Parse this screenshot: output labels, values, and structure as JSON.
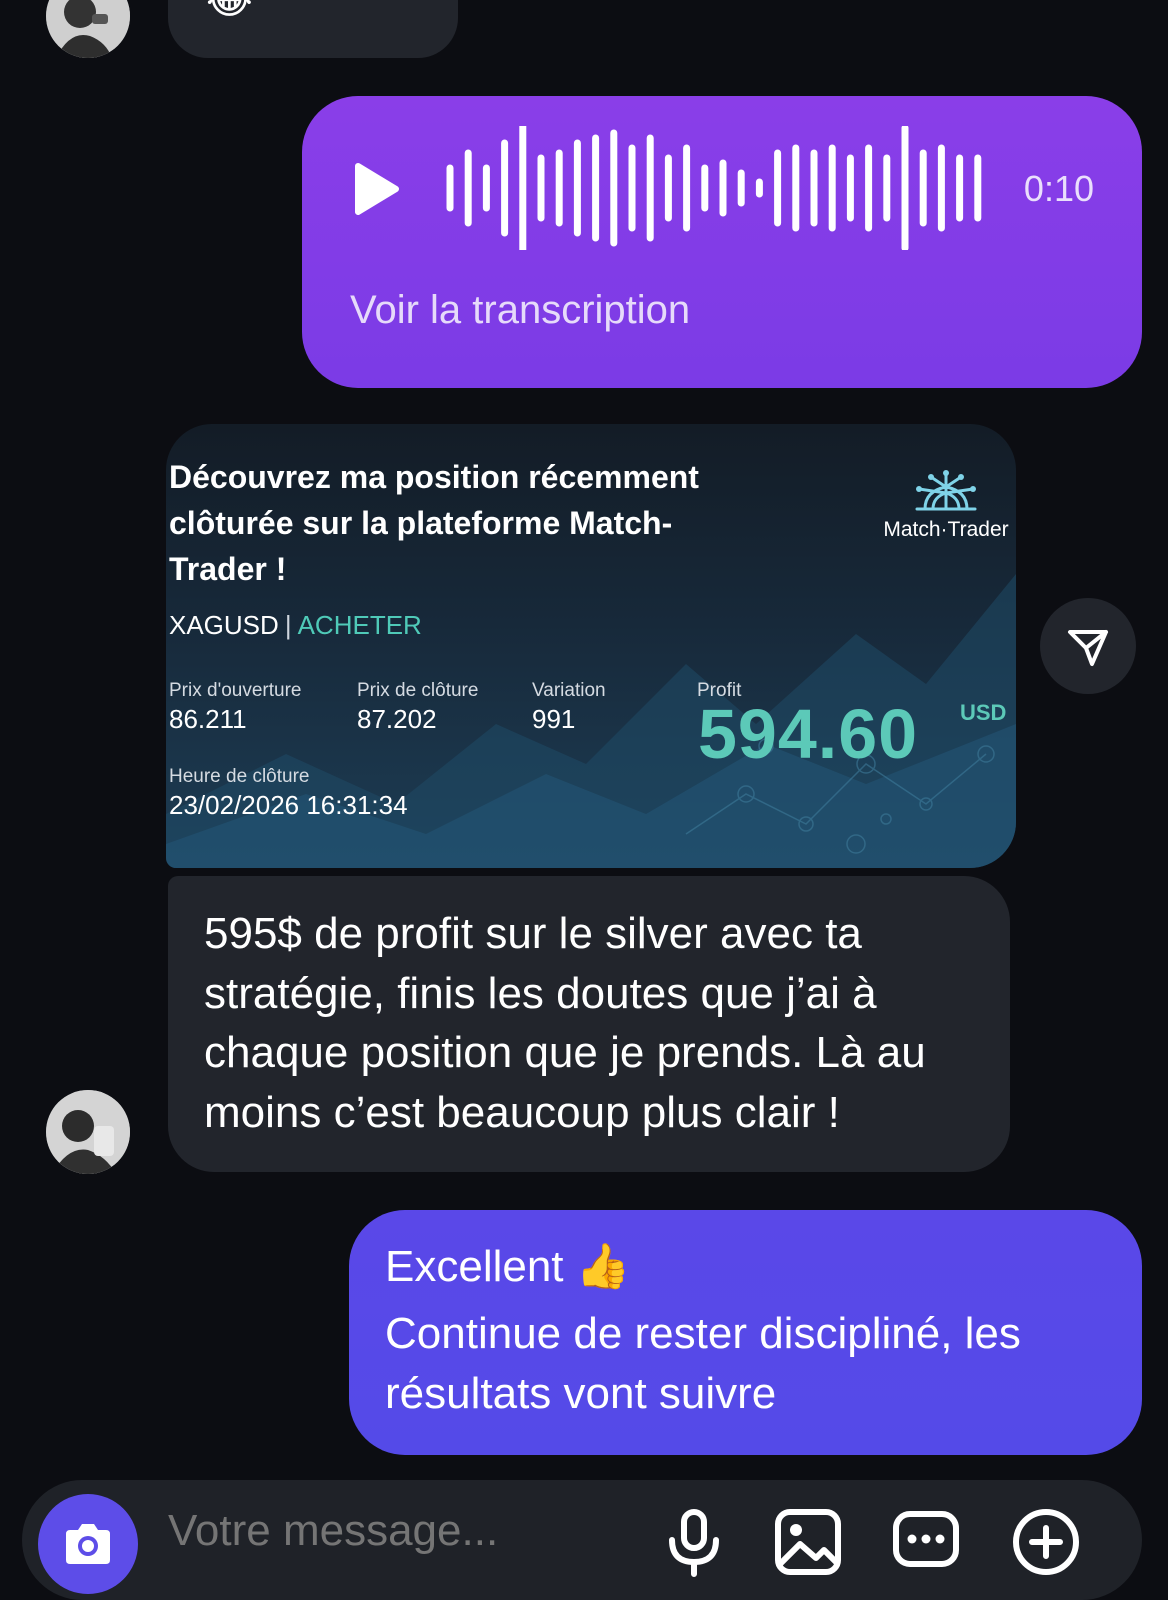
{
  "messages": {
    "top_incoming": {
      "emoji": "😂"
    },
    "voice": {
      "duration": "0:10",
      "transcript_link": "Voir la transcription"
    },
    "trade_card": {
      "title": "Découvrez ma position récemment clôturée sur la plateforme Match-Trader !",
      "brand": "Match·Trader",
      "symbol": "XAGUSD",
      "separator": "|",
      "direction": "ACHETER",
      "open_price_label": "Prix d'ouverture",
      "open_price": "86.211",
      "close_price_label": "Prix de clôture",
      "close_price": "87.202",
      "variation_label": "Variation",
      "variation": "991",
      "profit_label": "Profit",
      "profit": "594.60",
      "currency": "USD",
      "close_time_label": "Heure de clôture",
      "close_time": "23/02/2026 16:31:34"
    },
    "incoming_text": "595$ de profit sur le silver avec ta stratégie, finis les doutes que j’ai à chaque position que je prends. Là au moins c’est beaucoup plus clair !",
    "outgoing": {
      "line1": "Excellent 👍",
      "line2": "Continue de rester discipliné, les résultats vont suivre"
    }
  },
  "composer": {
    "placeholder": "Votre message..."
  },
  "icons": [
    "avatar",
    "play-icon",
    "waveform",
    "share-icon",
    "camera-icon",
    "microphone-icon",
    "image-icon",
    "chat-bubble-icon",
    "plus-circle-icon"
  ],
  "colors": {
    "background": "#0c0d12",
    "voice_bubble": "#8a3ee8",
    "outgoing_bubble": "#5a48e8",
    "incoming_bubble": "#22252c",
    "profit_green": "#5cc9b8"
  }
}
